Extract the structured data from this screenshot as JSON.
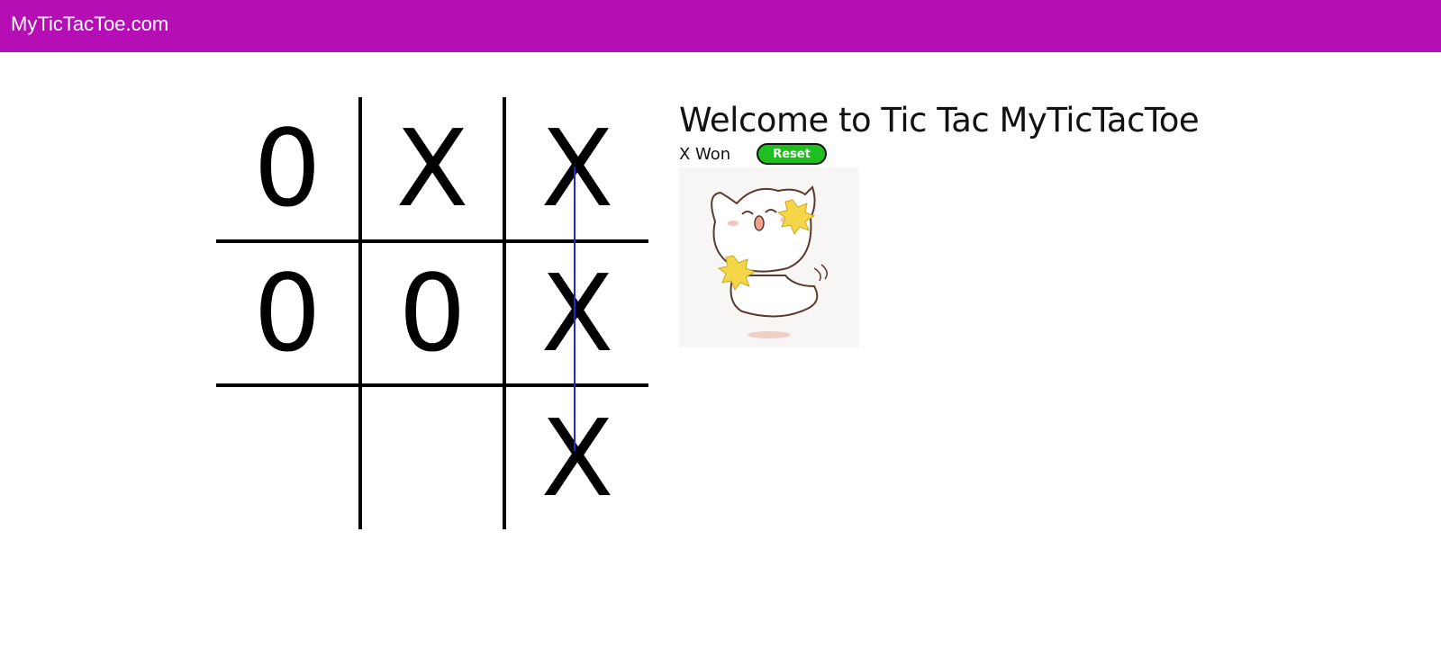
{
  "header": {
    "brand": "MyTicTacToe.com"
  },
  "board": {
    "cells": [
      [
        "0",
        "X",
        "X"
      ],
      [
        "0",
        "0",
        "X"
      ],
      [
        "",
        "",
        "X"
      ]
    ]
  },
  "panel": {
    "title": "Welcome to Tic Tac MyTicTacToe",
    "status": "X Won",
    "reset_label": "Reset"
  },
  "colors": {
    "header_bg": "#b50eb5",
    "win_line": "#2525d8",
    "reset_bg": "#1fbf1f"
  }
}
